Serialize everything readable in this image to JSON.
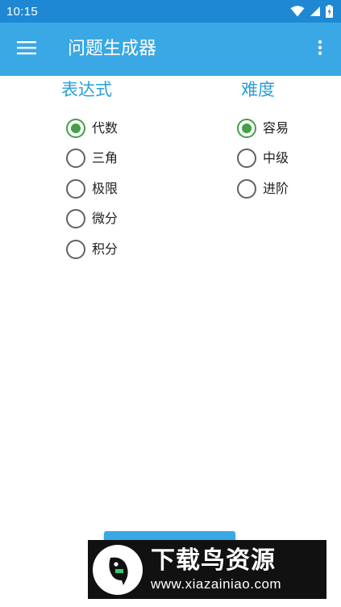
{
  "status_bar": {
    "time": "10:15",
    "icons": [
      "wifi-icon",
      "signal-icon",
      "battery-icon"
    ]
  },
  "app_bar": {
    "title": "问题生成器",
    "menu_icon": "hamburger-menu-icon",
    "overflow_icon": "more-vert-icon"
  },
  "expression": {
    "heading": "表达式",
    "options": [
      {
        "label": "代数",
        "checked": true
      },
      {
        "label": "三角",
        "checked": false
      },
      {
        "label": "极限",
        "checked": false
      },
      {
        "label": "微分",
        "checked": false
      },
      {
        "label": "积分",
        "checked": false
      }
    ]
  },
  "difficulty": {
    "heading": "难度",
    "options": [
      {
        "label": "容易",
        "checked": true
      },
      {
        "label": "中级",
        "checked": false
      },
      {
        "label": "进阶",
        "checked": false
      }
    ]
  },
  "watermark": {
    "main": "下载鸟资源",
    "url": "www.xiazainiao.com"
  },
  "colors": {
    "status_bar": "#1e88d5",
    "app_bar": "#3aa8e4",
    "heading": "#2a9fd8",
    "radio_checked": "#43a047",
    "radio_unchecked": "#616161"
  }
}
